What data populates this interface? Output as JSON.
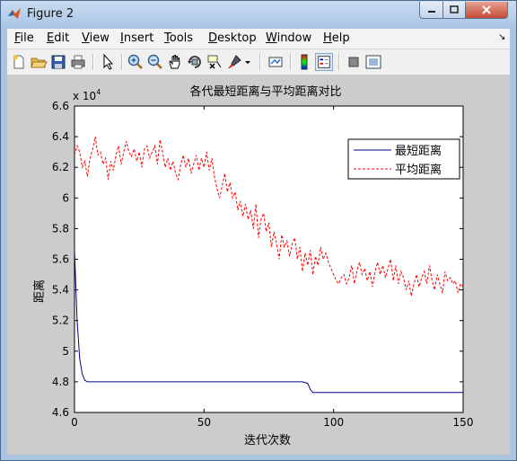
{
  "window": {
    "title": "Figure 2",
    "minimize_icon": "minimize-icon",
    "maximize_icon": "maximize-icon",
    "close_icon": "close-icon"
  },
  "menubar": {
    "items": [
      "File",
      "Edit",
      "View",
      "Insert",
      "Tools",
      "Desktop",
      "Window",
      "Help"
    ],
    "underlined": [
      "F",
      "E",
      "V",
      "I",
      "T",
      "D",
      "W",
      "H"
    ]
  },
  "toolbar": {
    "icons": [
      "new-figure-icon",
      "open-file-icon",
      "save-icon",
      "print-icon",
      "edit-plot-icon",
      "zoom-in-icon",
      "zoom-out-icon",
      "pan-icon",
      "rotate-3d-icon",
      "data-cursor-icon",
      "brush-icon",
      "link-plot-icon",
      "colorbar-icon",
      "legend-icon",
      "hide-plot-tools-icon",
      "show-plot-tools-icon"
    ]
  },
  "colors": {
    "series_best": "#00008b",
    "series_avg": "#ff0000",
    "figure_bg": "#cccccc"
  },
  "chart_data": {
    "type": "line",
    "title": "各代最短距离与平均距离对比",
    "xlabel": "迭代次数",
    "ylabel": "距离",
    "exponent_label": "x 10",
    "exponent_power": "4",
    "xlim": [
      0,
      150
    ],
    "ylim": [
      4.6,
      6.6
    ],
    "y_scale_factor": 10000,
    "xticks": [
      "0",
      "50",
      "100",
      "150"
    ],
    "yticks": [
      "4.6",
      "4.8",
      "5",
      "5.2",
      "5.4",
      "5.6",
      "5.8",
      "6",
      "6.2",
      "6.4",
      "6.6"
    ],
    "legend_position": "top-right",
    "grid": false,
    "series": [
      {
        "name": "最短距离",
        "style": "solid",
        "x": [
          0,
          1,
          2,
          3,
          4,
          5,
          10,
          20,
          30,
          40,
          50,
          60,
          70,
          80,
          88,
          90,
          91,
          92,
          93,
          100,
          110,
          120,
          130,
          140,
          150
        ],
        "y": [
          5.66,
          5.2,
          4.95,
          4.85,
          4.81,
          4.8,
          4.8,
          4.8,
          4.8,
          4.8,
          4.8,
          4.8,
          4.8,
          4.8,
          4.8,
          4.79,
          4.75,
          4.73,
          4.73,
          4.73,
          4.73,
          4.73,
          4.73,
          4.73,
          4.73
        ]
      },
      {
        "name": "平均距离",
        "style": "dashed",
        "x": [
          0,
          1,
          2,
          3,
          4,
          5,
          6,
          7,
          8,
          9,
          10,
          11,
          12,
          13,
          14,
          15,
          16,
          17,
          18,
          19,
          20,
          21,
          22,
          23,
          24,
          25,
          26,
          27,
          28,
          29,
          30,
          31,
          32,
          33,
          34,
          35,
          36,
          37,
          38,
          39,
          40,
          41,
          42,
          43,
          44,
          45,
          46,
          47,
          48,
          49,
          50,
          51,
          52,
          53,
          54,
          55,
          56,
          57,
          58,
          59,
          60,
          61,
          62,
          63,
          64,
          65,
          66,
          67,
          68,
          69,
          70,
          71,
          72,
          73,
          74,
          75,
          76,
          77,
          78,
          79,
          80,
          81,
          82,
          83,
          84,
          85,
          86,
          87,
          88,
          89,
          90,
          91,
          92,
          93,
          94,
          95,
          96,
          97,
          98,
          99,
          100,
          101,
          102,
          103,
          104,
          105,
          106,
          107,
          108,
          109,
          110,
          111,
          112,
          113,
          114,
          115,
          116,
          117,
          118,
          119,
          120,
          121,
          122,
          123,
          124,
          125,
          126,
          127,
          128,
          129,
          130,
          131,
          132,
          133,
          134,
          135,
          136,
          137,
          138,
          139,
          140,
          141,
          142,
          143,
          144,
          145,
          146,
          147,
          148,
          149,
          150
        ],
        "y": [
          6.28,
          6.34,
          6.3,
          6.2,
          6.24,
          6.14,
          6.26,
          6.32,
          6.4,
          6.28,
          6.3,
          6.22,
          6.26,
          6.12,
          6.24,
          6.18,
          6.28,
          6.34,
          6.22,
          6.3,
          6.37,
          6.3,
          6.27,
          6.32,
          6.24,
          6.3,
          6.2,
          6.32,
          6.34,
          6.26,
          6.3,
          6.34,
          6.22,
          6.38,
          6.3,
          6.2,
          6.26,
          6.18,
          6.24,
          6.16,
          6.12,
          6.22,
          6.28,
          6.2,
          6.26,
          6.16,
          6.22,
          6.28,
          6.18,
          6.26,
          6.2,
          6.3,
          6.18,
          6.26,
          6.14,
          6.06,
          6.0,
          6.08,
          6.16,
          6.04,
          6.1,
          6.0,
          6.04,
          5.92,
          5.98,
          5.88,
          5.96,
          5.86,
          5.92,
          5.8,
          5.96,
          5.74,
          5.86,
          5.9,
          5.78,
          5.84,
          5.68,
          5.78,
          5.7,
          5.6,
          5.76,
          5.68,
          5.72,
          5.62,
          5.7,
          5.74,
          5.6,
          5.68,
          5.52,
          5.64,
          5.56,
          5.66,
          5.5,
          5.62,
          5.56,
          5.68,
          5.6,
          5.64,
          5.58,
          5.54,
          5.5,
          5.46,
          5.44,
          5.48,
          5.5,
          5.44,
          5.48,
          5.56,
          5.44,
          5.52,
          5.58,
          5.5,
          5.54,
          5.46,
          5.52,
          5.42,
          5.52,
          5.58,
          5.5,
          5.56,
          5.48,
          5.54,
          5.6,
          5.46,
          5.56,
          5.44,
          5.52,
          5.48,
          5.4,
          5.46,
          5.36,
          5.44,
          5.5,
          5.42,
          5.48,
          5.52,
          5.44,
          5.56,
          5.46,
          5.4,
          5.5,
          5.44,
          5.38,
          5.52,
          5.46,
          5.48,
          5.44,
          5.46,
          5.38,
          5.44,
          5.42
        ]
      }
    ]
  }
}
